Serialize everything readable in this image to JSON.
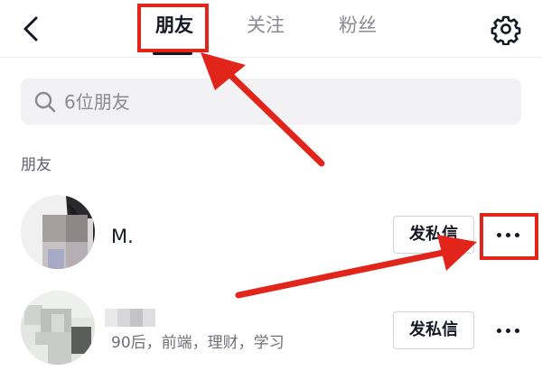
{
  "header": {
    "tabs": [
      {
        "label": "朋友",
        "active": true
      },
      {
        "label": "关注",
        "active": false
      },
      {
        "label": "粉丝",
        "active": false
      }
    ]
  },
  "search": {
    "placeholder": "6位朋友"
  },
  "section": {
    "label": "朋友"
  },
  "friends": [
    {
      "name": "M.",
      "bio": "",
      "dm_label": "发私信",
      "more_icon": "ellipsis-icon"
    },
    {
      "name": "",
      "bio": "90后，前端，理财，学习",
      "dm_label": "发私信",
      "more_icon": "ellipsis-icon"
    }
  ],
  "colors": {
    "annotation": "#e2251b",
    "text_primary": "#161823",
    "text_secondary": "#8a8b91",
    "search_bg": "#f2f2f4"
  }
}
